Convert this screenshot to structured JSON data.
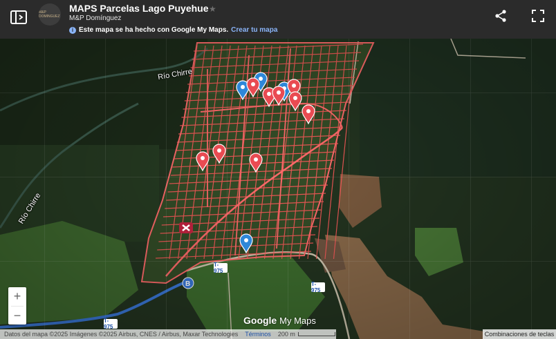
{
  "header": {
    "title": "MAPS Parcelas Lago Puyehue",
    "author": "M&P Domínguez",
    "logo_text": "M&P DOMINGUEZ",
    "info_text": "Este mapa se ha hecho con Google My Maps.",
    "info_link": "Crear tu mapa",
    "info_icon": "i",
    "star_icon": "★"
  },
  "map": {
    "labels": {
      "river_1": "Río Chirre",
      "river_2": "Río Chirre",
      "road_1": "T-975",
      "road_2": "T-975",
      "road_3": "T-975"
    },
    "waypoint_b": "B",
    "colors": {
      "parcel_outline": "#ff5a5a",
      "marker_red": "#e94b52",
      "marker_blue": "#2e87d8",
      "route": "#3a78d8"
    }
  },
  "controls": {
    "zoom_in": "+",
    "zoom_out": "−"
  },
  "footer": {
    "attribution": "Datos del mapa ©2025 Imágenes ©2025 Airbus, CNES / Airbus, Maxar Technologies",
    "terms": "Términos",
    "scale": "200 m",
    "keyboard": "Combinaciones de teclas"
  },
  "branding": {
    "google": "Google",
    "mymaps": "My Maps"
  }
}
